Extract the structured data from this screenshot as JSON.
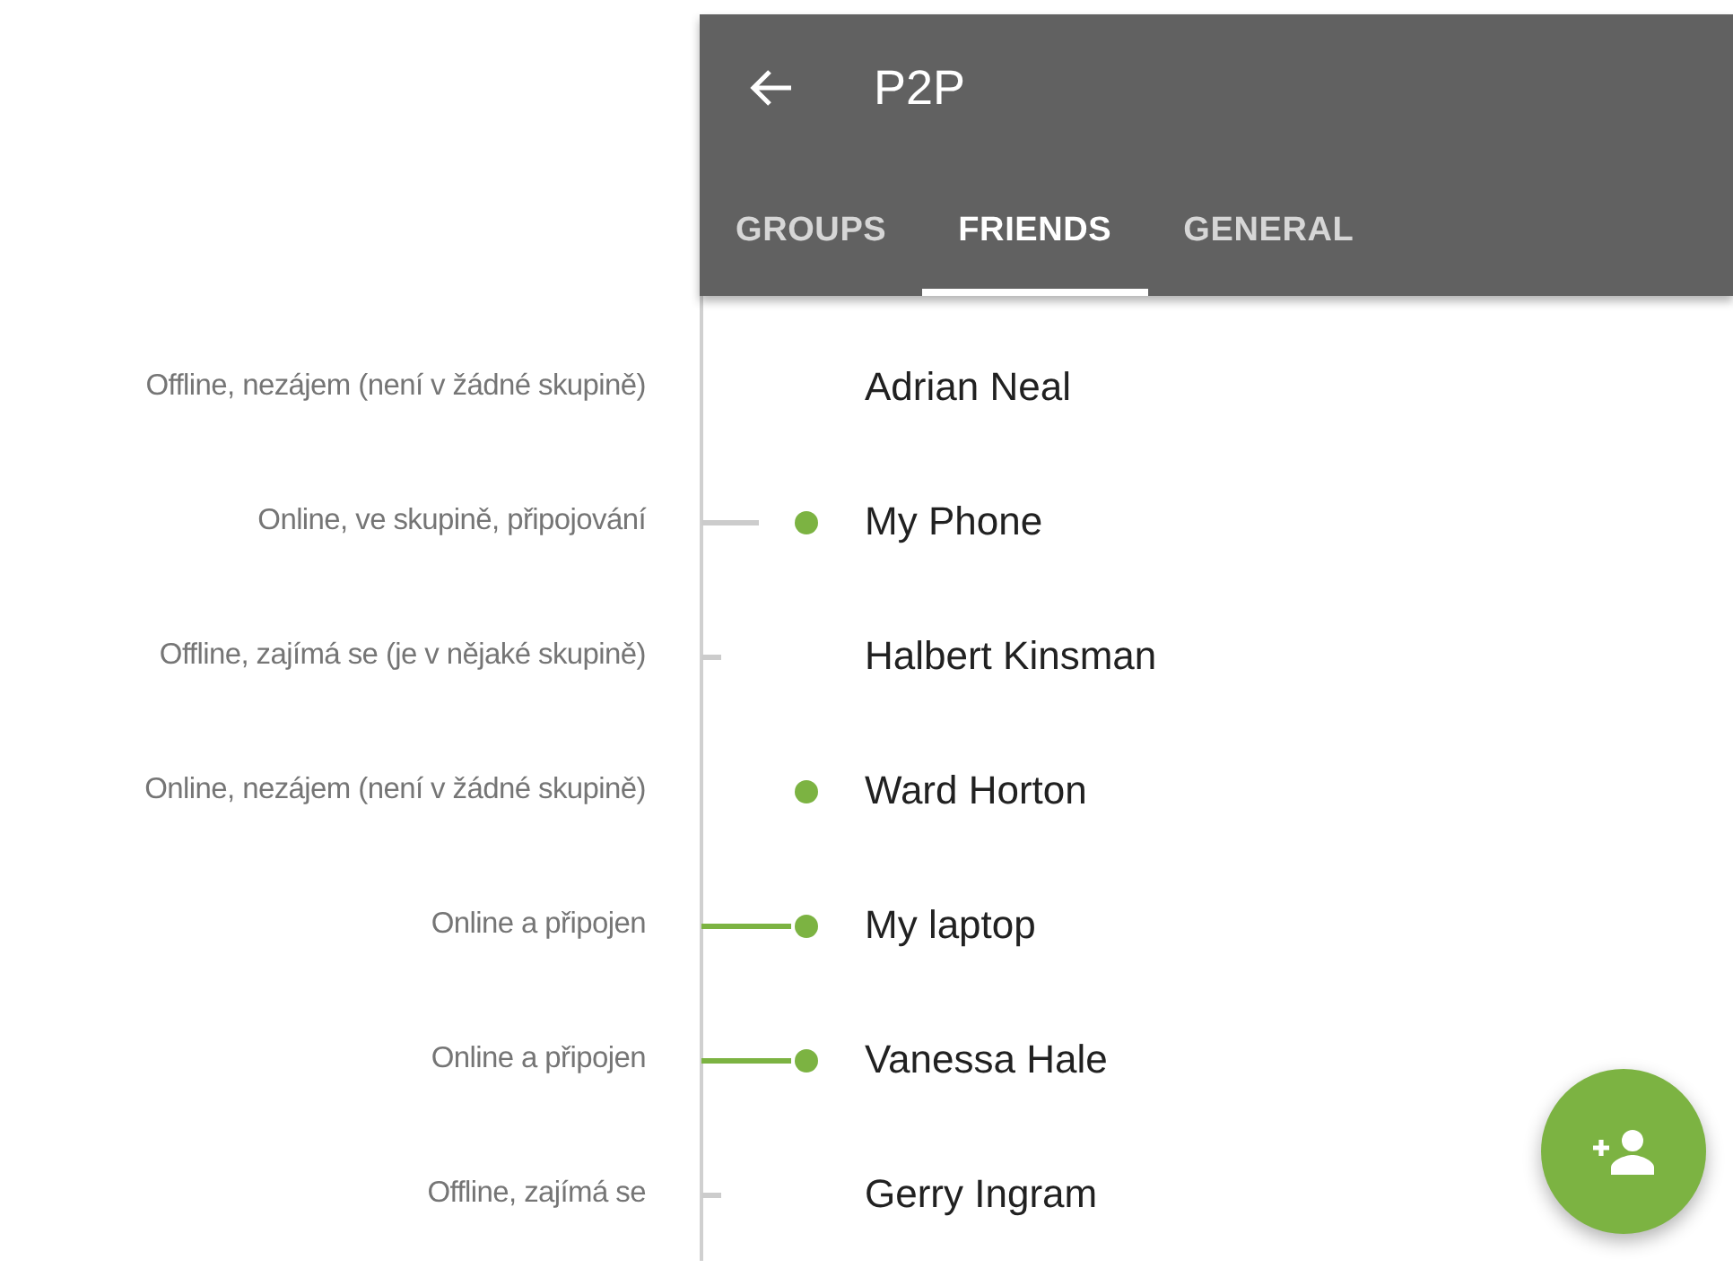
{
  "app_bar": {
    "title": "P2P"
  },
  "tabs": [
    {
      "label": "GROUPS",
      "selected": false
    },
    {
      "label": "FRIENDS",
      "selected": true
    },
    {
      "label": "GENERAL",
      "selected": false
    }
  ],
  "friends": [
    {
      "annotation": "Offline, nezájem (není v žádné skupině)",
      "name": "Adrian Neal",
      "online": false,
      "kind": "none"
    },
    {
      "annotation": "Online, ve skupině, připojování",
      "name": "My Phone",
      "online": true,
      "kind": "connecting"
    },
    {
      "annotation": "Offline, zajímá se (je v nějaké skupině)",
      "name": "Halbert Kinsman",
      "online": false,
      "kind": "interested"
    },
    {
      "annotation": "Online, nezájem (není v žádné skupině)",
      "name": "Ward Horton",
      "online": true,
      "kind": "none"
    },
    {
      "annotation": "Online a připojen",
      "name": "My laptop",
      "online": true,
      "kind": "connected"
    },
    {
      "annotation": "Online a připojen",
      "name": "Vanessa Hale",
      "online": true,
      "kind": "connected"
    },
    {
      "annotation": "Offline, zajímá se",
      "name": "Gerry Ingram",
      "online": false,
      "kind": "interested"
    }
  ]
}
